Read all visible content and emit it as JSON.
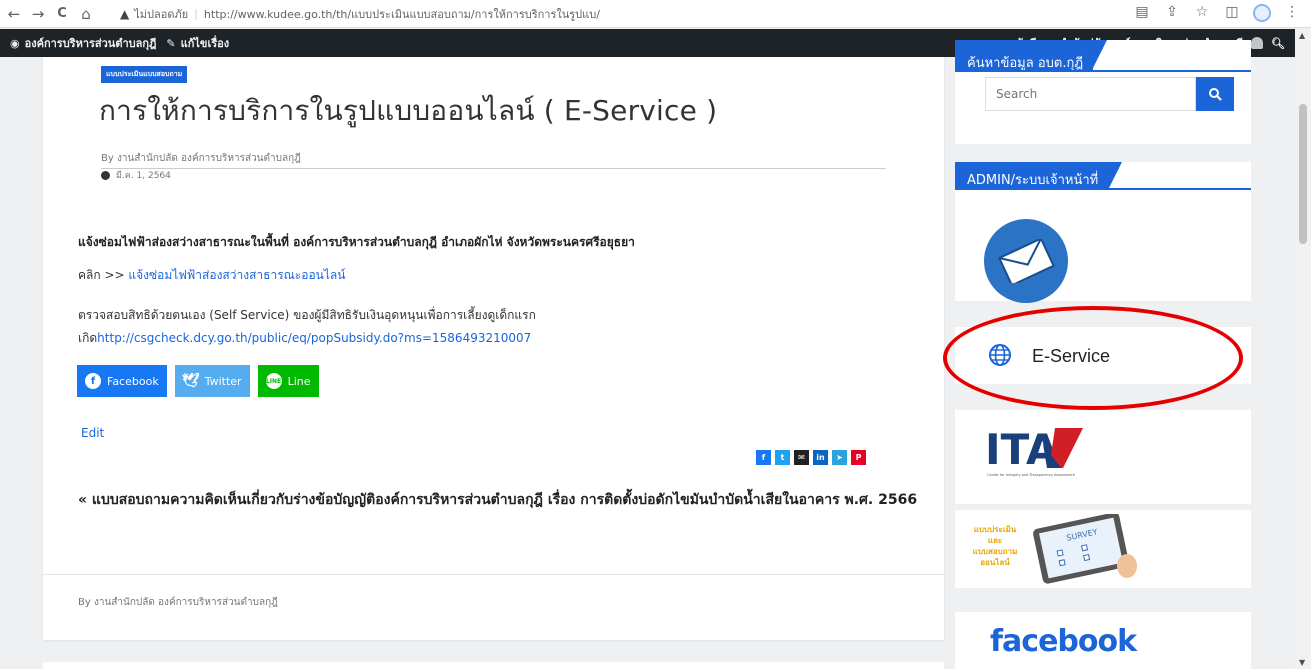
{
  "browser": {
    "back": "←",
    "forward": "→",
    "reload": "C",
    "home": "⌂",
    "security_icon": "▲",
    "security_label": "ไม่ปลอดภัย",
    "url": "http://www.kudee.go.th/th/แบบประเมินแบบสอบถาม/การให้การบริการในรูปแบ/"
  },
  "adminbar": {
    "site_name": "องค์การบริหารส่วนตำบลกุฎี",
    "edit_label": "แก้ไขเรื่อง",
    "greeting": "สวัสดี งานสำนักปลัด องค์การบริหารส่วนตำบลกุฎี"
  },
  "post": {
    "category": "แบบประเมินแบบสอบถาม",
    "title": "การให้การบริการในรูปแบบออนไลน์ ( E-Service )",
    "byline": "By งานสำนักปลัด องค์การบริหารส่วนตำบลกุฎี",
    "date": "มี.ค. 1, 2564",
    "p1": "แจ้งซ่อมไฟฟ้าส่องสว่างสาธารณะในพื้นที่ องค์การบริหารส่วนตำบลกุฎี อำเภอผักไห่ จังหวัดพระนครศรีอยุธยา",
    "p2_prefix": "คลิก >> ",
    "p2_link": "แจ้งซ่อมไฟฟ้าส่องสว่างสาธารณะออนไลน์",
    "p3": "ตรวจสอบสิทธิด้วยตนเอง (Self Service) ของผู้มีสิทธิรับเงินอุดหนุนเพื่อการเลี้ยงดูเด็กแรก",
    "p4_prefix": "เกิด",
    "p4_link": "http://csgcheck.dcy.go.th/public/eq/popSubsidy.do?ms=1586493210007",
    "share": {
      "facebook": "Facebook",
      "twitter": "Twitter",
      "line": "Line"
    },
    "edit": "Edit",
    "prev_arrow": "«",
    "prev_post": "แบบสอบถามความคิดเห็นเกี่ยวกับร่างข้อบัญญัติองค์การบริหารส่วนตำบลกุฎี เรื่อง การติดตั้งบ่อดักไขมันบำบัดน้ำเสียในอาคาร พ.ศ. 2566",
    "author_footer": "By งานสำนักปลัด องค์การบริหารส่วนตำบลกุฎี"
  },
  "sidebar": {
    "search_widget_title": "ค้นหาข้อมูล อบต.กุฎี",
    "search_placeholder": "Search",
    "admin_widget_title": "ADMIN/ระบบเจ้าหน้าที่",
    "eservice_label": "E-Service",
    "ita_label": "ITA",
    "ita_caption": "Center for Integrity and Transparency Assessment",
    "survey_lines": [
      "แบบประเมิน",
      "และ",
      "แบบสอบถาม",
      "ออนไลน์"
    ],
    "survey_word": "SURVEY",
    "facebook_label": "facebook"
  },
  "colors": {
    "brand_blue": "#1b65d8",
    "admin_bar": "#1d2327",
    "highlight_red": "#e50000"
  }
}
